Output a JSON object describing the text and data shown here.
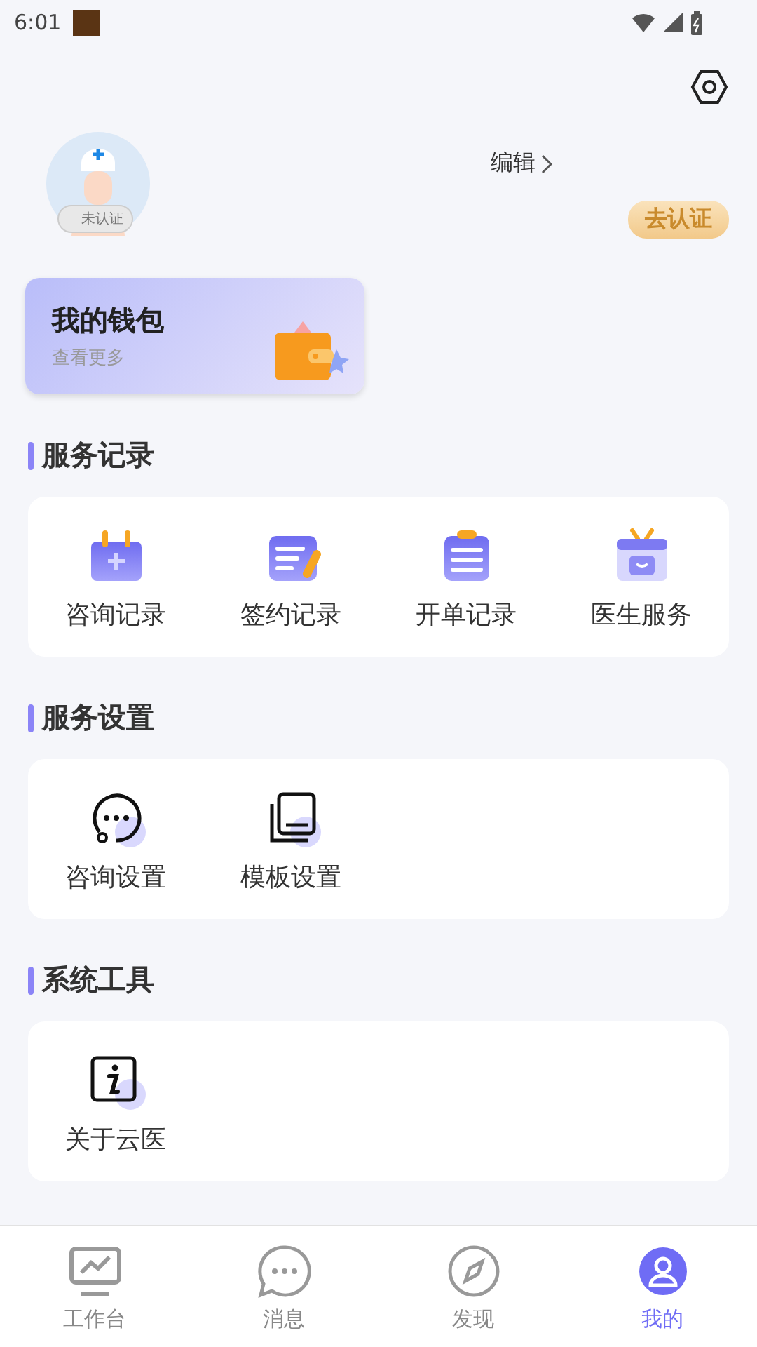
{
  "status_bar": {
    "time": "6:01"
  },
  "profile": {
    "badge": "未认证",
    "edit": "编辑",
    "verify_button": "去认证"
  },
  "wallet": {
    "title": "我的钱包",
    "subtitle": "查看更多"
  },
  "sections": [
    {
      "title": "服务记录",
      "items": [
        {
          "label": "咨询记录",
          "kind": "calendar"
        },
        {
          "label": "签约记录",
          "kind": "note"
        },
        {
          "label": "开单记录",
          "kind": "clipboard"
        },
        {
          "label": "医生服务",
          "kind": "box"
        }
      ]
    },
    {
      "title": "服务设置",
      "items": [
        {
          "label": "咨询设置",
          "kind": "chat"
        },
        {
          "label": "模板设置",
          "kind": "template"
        }
      ]
    },
    {
      "title": "系统工具",
      "items": [
        {
          "label": "关于云医",
          "kind": "info"
        }
      ]
    }
  ],
  "tabs": [
    {
      "label": "工作台",
      "kind": "monitor",
      "selected": false
    },
    {
      "label": "消息",
      "kind": "message",
      "selected": false
    },
    {
      "label": "发现",
      "kind": "compass",
      "selected": false
    },
    {
      "label": "我的",
      "kind": "person",
      "selected": true
    }
  ]
}
